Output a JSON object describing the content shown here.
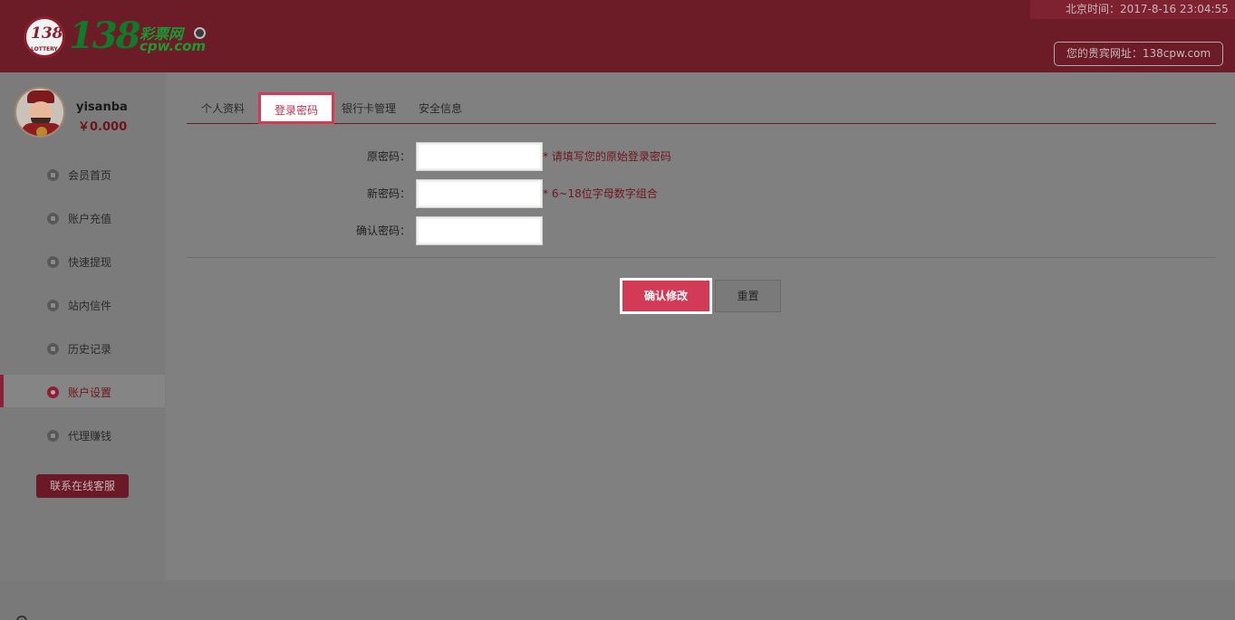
{
  "header": {
    "logo_circle_num": "138",
    "logo_circle_sub": "LOTTERY",
    "logo_num": "138",
    "logo_cn": "彩票网",
    "logo_en": "cpw.com",
    "time_text": "北京时间：2017-8-16 23:04:55",
    "guest_url": "您的贵宾网址：138cpw.com"
  },
  "user": {
    "name": "yisanba",
    "balance": "￥0.000"
  },
  "sidebar": {
    "items": [
      {
        "label": "会员首页",
        "icon": "home-icon"
      },
      {
        "label": "账户充值",
        "icon": "deposit-icon"
      },
      {
        "label": "快速提现",
        "icon": "withdraw-icon"
      },
      {
        "label": "站内信件",
        "icon": "mail-icon"
      },
      {
        "label": "历史记录",
        "icon": "clock-icon"
      },
      {
        "label": "账户设置",
        "icon": "settings-icon",
        "active": true
      },
      {
        "label": "代理赚钱",
        "icon": "agent-icon"
      }
    ],
    "service_label": "联系在线客服"
  },
  "tabs": [
    {
      "label": "个人资料"
    },
    {
      "label": "登录密码",
      "active": true
    },
    {
      "label": "银行卡管理"
    },
    {
      "label": "安全信息"
    }
  ],
  "form": {
    "old_password": {
      "label": "原密码：",
      "value": "",
      "hint": "* 请填写您的原始登录密码"
    },
    "new_password": {
      "label": "新密码：",
      "value": "",
      "hint": "* 6~18位字母数字组合"
    },
    "confirm_password": {
      "label": "确认密码：",
      "value": ""
    }
  },
  "buttons": {
    "confirm": "确认修改",
    "reset": "重置"
  },
  "colors": {
    "header_bg": "#6b1c27",
    "accent": "#d23a55",
    "overlay_gray": "#7d7d7d"
  }
}
